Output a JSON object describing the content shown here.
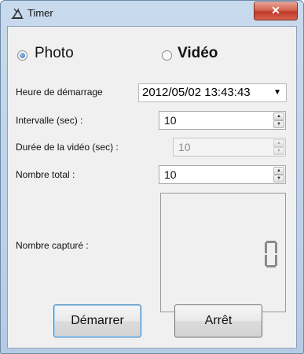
{
  "window": {
    "title": "Timer",
    "close_glyph": "✕"
  },
  "mode": {
    "photo_label": "Photo",
    "video_label": "Vidéo",
    "selected": "photo"
  },
  "start_time": {
    "label": "Heure de démarrage",
    "value": "2012/05/02 13:43:43"
  },
  "interval": {
    "label": "Intervalle (sec) :",
    "value": "10"
  },
  "video_duration": {
    "label": "Durée de la vidéo (sec) :",
    "value": "10",
    "enabled": false
  },
  "total_count": {
    "label": "Nombre total :",
    "value": "10"
  },
  "captured": {
    "label": "Nombre capturé :",
    "value": "0"
  },
  "buttons": {
    "start_label": "Démarrer",
    "stop_label": "Arrêt"
  }
}
